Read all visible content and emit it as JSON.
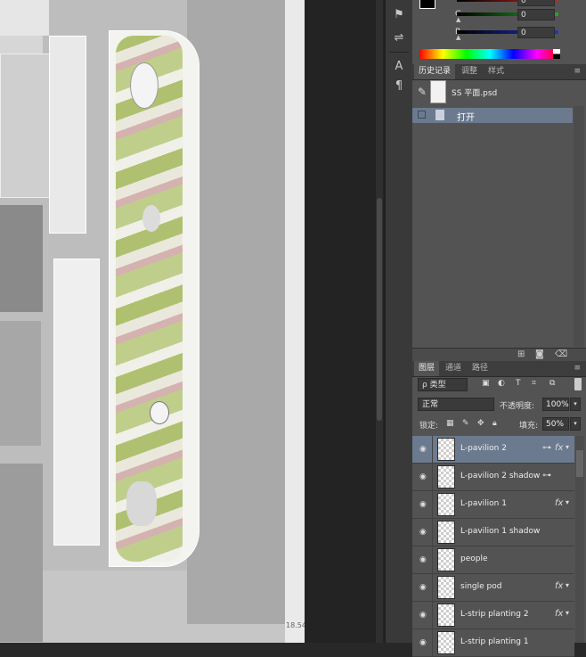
{
  "canvas": {
    "zoom_label": "18.54"
  },
  "toolstrip": {
    "icons": [
      "clone-stamp-icon",
      "brush-settings-icon",
      "character-icon",
      "paragraph-icon"
    ]
  },
  "color_panel": {
    "channels": [
      {
        "label": "",
        "value": "0",
        "color": "#cc2222"
      },
      {
        "label": "G",
        "value": "0",
        "color": "#22aa22"
      },
      {
        "label": "B",
        "value": "0",
        "color": "#2233cc"
      }
    ]
  },
  "history_panel": {
    "tabs": [
      "历史记录",
      "调整",
      "样式"
    ],
    "snapshot_name": "SS 平面.psd",
    "open_label": "打开"
  },
  "layers_panel": {
    "tabs": [
      "图层",
      "通道",
      "路径"
    ],
    "filter_label": "ρ 类型",
    "blend_mode": "正常",
    "opacity_label": "不透明度:",
    "opacity_value": "100%",
    "lock_label": "锁定:",
    "fill_label": "填充:",
    "fill_value": "50%",
    "layers": [
      {
        "name": "L-pavilion 2",
        "selected": true,
        "link": true,
        "fx": true
      },
      {
        "name": "L-pavilion 2 shadow",
        "selected": false,
        "link": true,
        "fx": false
      },
      {
        "name": "L-pavilion 1",
        "selected": false,
        "link": false,
        "fx": true
      },
      {
        "name": "L-pavilion 1 shadow",
        "selected": false,
        "link": false,
        "fx": false
      },
      {
        "name": "people",
        "selected": false,
        "link": false,
        "fx": false
      },
      {
        "name": "single pod",
        "selected": false,
        "link": false,
        "fx": true
      },
      {
        "name": "L-strip planting 2",
        "selected": false,
        "link": false,
        "fx": true
      },
      {
        "name": "L-strip planting 1",
        "selected": false,
        "link": false,
        "fx": false
      }
    ]
  }
}
